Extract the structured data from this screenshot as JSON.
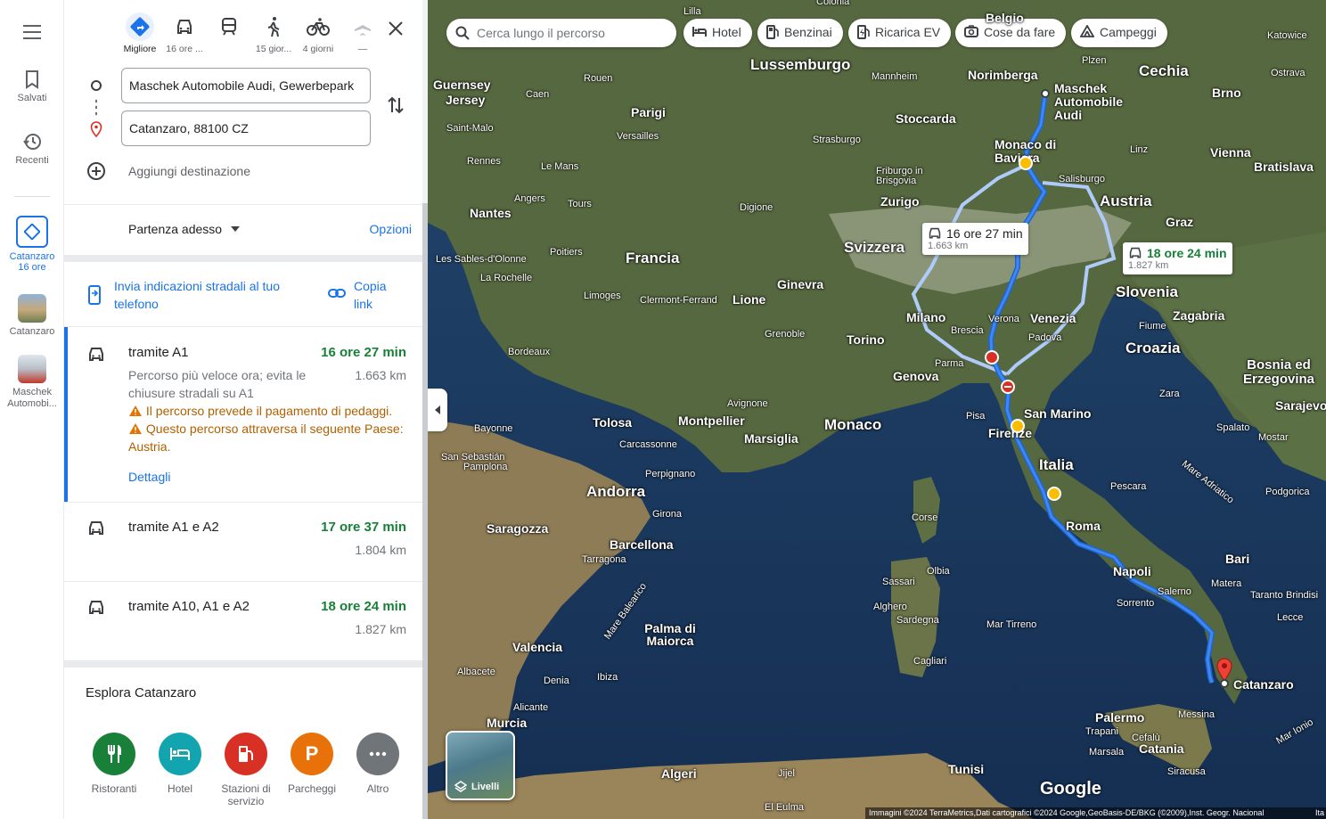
{
  "rail": {
    "saved": "Salvati",
    "recent": "Recenti",
    "active_item": {
      "name": "Catanzaro",
      "sub": "16 ore"
    },
    "place1": "Catanzaro",
    "place2": "Maschek Automobi..."
  },
  "modes": [
    {
      "label": "Migliore"
    },
    {
      "label": "16 ore ..."
    },
    {
      "label": ""
    },
    {
      "label": "15 gior..."
    },
    {
      "label": "4 giorni"
    },
    {
      "label": "—"
    }
  ],
  "origin_value": "Maschek Automobile Audi, Gewerbepark",
  "destination_value": "Catanzaro, 88100 CZ",
  "add_destination": "Aggiungi destinazione",
  "departure": "Partenza adesso",
  "options": "Opzioni",
  "send_directions": "Invia indicazioni stradali al tuo telefono",
  "copy_link": "Copia link",
  "routes": [
    {
      "title": "tramite A1",
      "time": "16 ore 27 min",
      "distance": "1.663 km",
      "desc": "Percorso più veloce ora; evita le chiusure stradali su A1",
      "warn1": "Il percorso prevede il pagamento di pedaggi.",
      "warn2": "Questo percorso attraversa il seguente Paese: Austria.",
      "details": "Dettagli"
    },
    {
      "title": "tramite A1 e A2",
      "time": "17 ore 37 min",
      "distance": "1.804 km"
    },
    {
      "title": "tramite A10, A1 e A2",
      "time": "18 ore 24 min",
      "distance": "1.827 km"
    }
  ],
  "explore": {
    "title": "Esplora Catanzaro",
    "categories": [
      {
        "label": "Ristoranti",
        "color": "#188038"
      },
      {
        "label": "Hotel",
        "color": "#12a4af"
      },
      {
        "label": "Stazioni di servizio",
        "color": "#d93025"
      },
      {
        "label": "Parcheggi",
        "color": "#e8710a",
        "glyph": "P"
      },
      {
        "label": "Altro",
        "color": "#70757a"
      }
    ]
  },
  "map": {
    "search_placeholder": "Cerca lungo il percorso",
    "chips": [
      "Hotel",
      "Benzinai",
      "Ricarica EV",
      "Cose da fare",
      "Campeggi"
    ],
    "callout_main": {
      "time": "16 ore 27 min",
      "dist": "1.663 km"
    },
    "callout_alt": {
      "time": "18 ore 24 min",
      "dist": "1.827 km"
    },
    "layers": "Livelli",
    "google": "Google",
    "attribution": "Immagini ©2024 TerraMetrics,Dati cartografici ©2024 Google,GeoBasis-DE/BKG (©2009),Inst. Geogr. Nacional",
    "attribution_tail": "Ita",
    "origin_label": "Maschek Automobile Audi",
    "dest_label": "Catanzaro",
    "labels_big": [
      "Lussemburgo",
      "Cechia",
      "Francia",
      "Svizzera",
      "Austria",
      "Slovenia",
      "Croazia",
      "Bosnia ed Erzegovina",
      "Italia",
      "Monaco",
      "Andorra",
      "San Marino"
    ],
    "labels_mid": [
      "Norimberga",
      "Stoccarda",
      "Parigi",
      "Nantes",
      "Zurigo",
      "Ginevra",
      "Lione",
      "Milano",
      "Torino",
      "Genova",
      "Venezia",
      "Tolosa",
      "Montpellier",
      "Marsiglia",
      "Roma",
      "Napoli",
      "Bari",
      "Palermo",
      "Catania",
      "Barcellona",
      "Valencia",
      "Saragozza",
      "Tunisi",
      "Algeri",
      "Brno",
      "Vienna",
      "Bratislava",
      "Graz",
      "Zagabria",
      "Sarajevo",
      "Monaco di Baviera",
      "Firenze",
      "Messina"
    ],
    "labels_small": [
      "Rouen",
      "Caen",
      "Le Mans",
      "Tours",
      "Angers",
      "Rennes",
      "Saint-Malo",
      "Versailles",
      "Mannheim",
      "Strasburgo",
      "Friburgo in Brisgovia",
      "Linz",
      "Salisburgo",
      "Digione",
      "Limoges",
      "Clermont-Ferrand",
      "Grenoble",
      "Avignone",
      "Bordeaux",
      "Poitiers",
      "Les Sables-d'Olonne",
      "La Rochelle",
      "Bayonne",
      "Pamplona",
      "San Sebastián",
      "Perpignano",
      "Carcassonne",
      "Girona",
      "Tarragona",
      "Verona",
      "Padova",
      "Brescia",
      "Parma",
      "Pisa",
      "Zara",
      "Spalato",
      "Mostar",
      "Pescara",
      "Sassari",
      "Olbia",
      "Alghero",
      "Sardegna",
      "Cagliari",
      "Salerno",
      "Sorrento",
      "Matera",
      "Taranto",
      "Brindisi",
      "Lecce",
      "Trapani",
      "Marsala",
      "Cefalù",
      "Siracusa",
      "Corse",
      "Palma di Maiorca",
      "Ibiza",
      "Alicante",
      "Denia",
      "Murcia",
      "Albacete",
      "Jijel",
      "El Eulma",
      "Mar Tirreno",
      "Mare Adriatico",
      "Mare Balearico",
      "Mar Ionio",
      "Plzen",
      "Ostrava",
      "Katowice",
      "Colonia",
      "Belgio",
      "Lilla",
      "Jersey",
      "Guernsey",
      "Fiume",
      "Podgorica"
    ]
  }
}
